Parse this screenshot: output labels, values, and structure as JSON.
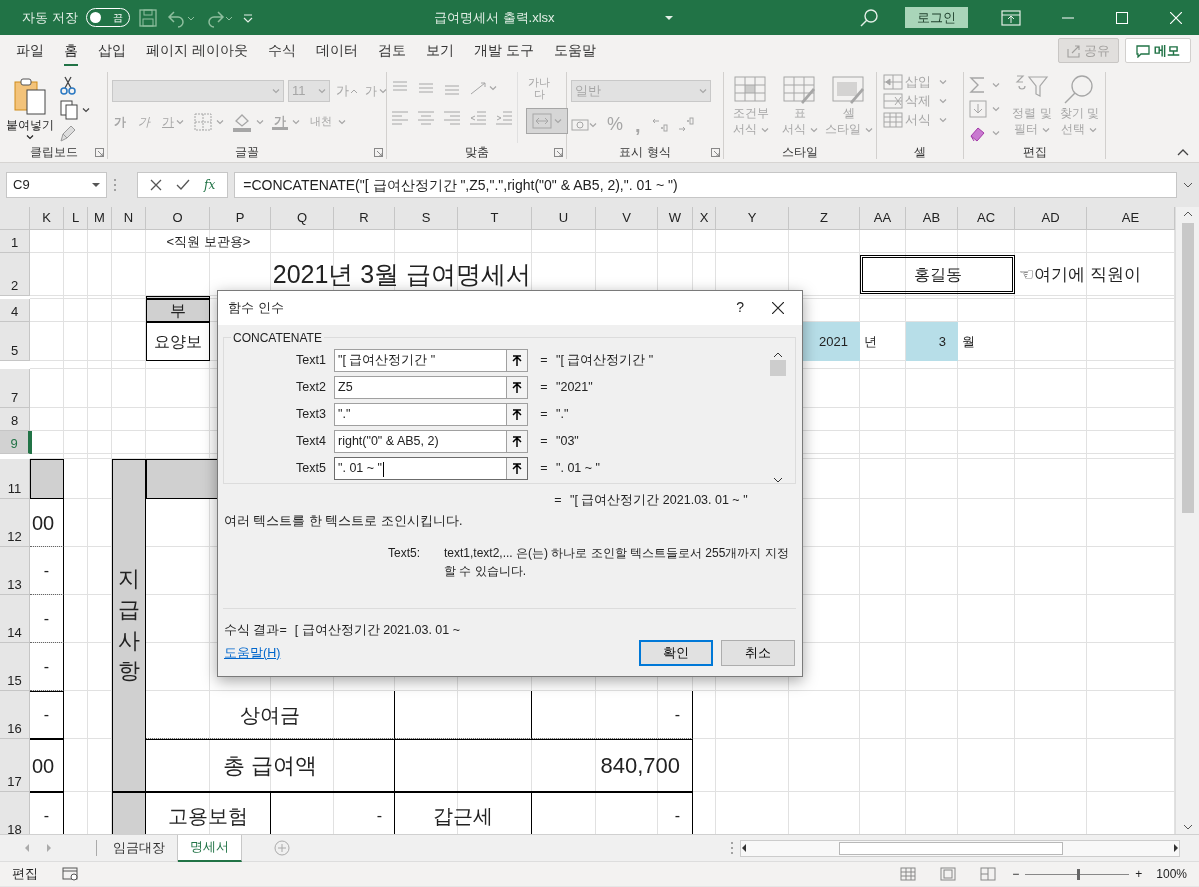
{
  "title_bar": {
    "autosave_label": "자동 저장",
    "autosave_on": false,
    "autosave_state": "끔",
    "title": "급여명세서 출력.xlsx",
    "login": "로그인"
  },
  "ribbon_tabs": [
    {
      "label": "파일",
      "selected": false
    },
    {
      "label": "홈",
      "selected": true
    },
    {
      "label": "삽입",
      "selected": false
    },
    {
      "label": "페이지 레이아웃",
      "selected": false
    },
    {
      "label": "수식",
      "selected": false
    },
    {
      "label": "데이터",
      "selected": false
    },
    {
      "label": "검토",
      "selected": false
    },
    {
      "label": "보기",
      "selected": false
    },
    {
      "label": "개발 도구",
      "selected": false
    },
    {
      "label": "도움말",
      "selected": false
    }
  ],
  "share": {
    "label": "공유",
    "disabled": true
  },
  "memo": {
    "label": "메모"
  },
  "ribbon": {
    "groups": [
      {
        "kind": "clipboard",
        "label": "클립보드",
        "disabled": false,
        "paste": "붙여넣기"
      },
      {
        "kind": "font",
        "label": "글꼴",
        "disabled": true,
        "size": "11",
        "grow": "가",
        "shrink": "가",
        "bold": "가",
        "italic": "가",
        "underline": "가",
        "font_color": "가",
        "phonetic": "내천"
      },
      {
        "kind": "align",
        "label": "맞춤",
        "disabled": true,
        "wrap": "가나다",
        "merge_on": true
      },
      {
        "kind": "number",
        "label": "표시 형식",
        "disabled": true,
        "format": "일반",
        "percent": "%",
        "comma": ","
      },
      {
        "kind": "styles",
        "label": "스타일",
        "disabled": true,
        "items": [
          {
            "lines": [
              "조건부",
              "서식"
            ]
          },
          {
            "lines": [
              "표",
              "서식"
            ]
          },
          {
            "lines": [
              "셀",
              "스타일"
            ]
          }
        ]
      },
      {
        "kind": "cells",
        "label": "셀",
        "disabled": true,
        "items": [
          "삽입",
          "삭제",
          "서식"
        ]
      },
      {
        "kind": "editing",
        "label": "편집",
        "disabled": true,
        "items": [
          {
            "lines": [
              "정렬 및",
              "필터"
            ]
          },
          {
            "lines": [
              "찾기 및",
              "선택"
            ]
          }
        ]
      }
    ]
  },
  "formula_bar": {
    "name_box": "C9",
    "insert_function": "fx",
    "formula": "=CONCATENATE(\"[ 급여산정기간 \",Z5,\".\",right(\"0\" & AB5, 2),\". 01 ~ \")"
  },
  "sheet": {
    "columns": [
      {
        "label": "K"
      },
      {
        "label": "L"
      },
      {
        "label": "M"
      },
      {
        "label": "N"
      },
      {
        "label": "O"
      },
      {
        "label": "P"
      },
      {
        "label": "Q"
      },
      {
        "label": "R"
      },
      {
        "label": "S"
      },
      {
        "label": "T"
      },
      {
        "label": "U"
      },
      {
        "label": "V"
      },
      {
        "label": "W"
      },
      {
        "label": "X"
      },
      {
        "label": "Y"
      },
      {
        "label": "Z"
      },
      {
        "label": "AA"
      },
      {
        "label": "AB"
      },
      {
        "label": "AC"
      },
      {
        "label": "AD"
      },
      {
        "label": "AE"
      }
    ],
    "rows": [
      {
        "label": "1",
        "selected": false
      },
      {
        "label": "2",
        "selected": false
      },
      {
        "label": "4",
        "selected": false
      },
      {
        "label": "5",
        "selected": false
      },
      {
        "label": "7",
        "selected": false
      },
      {
        "label": "8",
        "selected": false
      },
      {
        "label": "9",
        "selected": true
      },
      {
        "label": "11",
        "selected": false
      },
      {
        "label": "12",
        "selected": false
      },
      {
        "label": "13",
        "selected": false
      },
      {
        "label": "14",
        "selected": false
      },
      {
        "label": "15",
        "selected": false
      },
      {
        "label": "16",
        "selected": false
      },
      {
        "label": "17",
        "selected": false
      },
      {
        "label": "18",
        "selected": false
      }
    ],
    "cells": [
      {
        "text": "<직원 보관용>"
      },
      {
        "text": "2021년 3월 급여명세서"
      },
      {
        "text": "홍길동"
      },
      {
        "text": "☜여기에 직원이"
      },
      {
        "text": "부"
      },
      {
        "text": "요양보"
      },
      {
        "text": "2021"
      },
      {
        "text": "년"
      },
      {
        "text": "3"
      },
      {
        "text": "월"
      },
      {
        "text": "00"
      },
      {
        "text": "-"
      },
      {
        "text": "-"
      },
      {
        "text": "-"
      },
      {
        "text": "-"
      },
      {
        "text": "00"
      },
      {
        "text": "-"
      },
      {
        "text": "지급사항"
      },
      {
        "text": "상여금"
      },
      {
        "text": "-"
      },
      {
        "text": "총 급여액"
      },
      {
        "text": "840,700"
      },
      {
        "text": "고용보험"
      },
      {
        "text": "-"
      },
      {
        "text": "갑근세"
      },
      {
        "text": "-"
      }
    ]
  },
  "dialog": {
    "title": "함수 인수",
    "help": "?",
    "function": "CONCATENATE",
    "args": [
      {
        "label": "Text1",
        "value": "\"[ 급여산정기간 \"",
        "eq": "=",
        "result": "\"[ 급여산정기간 \"",
        "focused": false
      },
      {
        "label": "Text2",
        "value": "Z5",
        "eq": "=",
        "result": "\"2021\"",
        "focused": false
      },
      {
        "label": "Text3",
        "value": "\".\"",
        "eq": "=",
        "result": "\".\"",
        "focused": false
      },
      {
        "label": "Text4",
        "value": "right(\"0\" & AB5, 2)",
        "eq": "=",
        "result": "\"03\"",
        "focused": false
      },
      {
        "label": "Text5",
        "value": "\". 01 ~ \"",
        "eq": "=",
        "result": "\". 01 ~ \"",
        "focused": true
      }
    ],
    "total_eq": "=",
    "total": "\"[ 급여산정기간 2021.03. 01 ~ \"",
    "description": "여러 텍스트를 한 텍스트로 조인시킵니다.",
    "arg_help_label": "Text5:",
    "arg_help": "text1,text2,... 은(는) 하나로 조인할 텍스트들로서 255개까지 지정할 수 있습니다.",
    "result_label": "수식 결과=",
    "result": "[ 급여산정기간 2021.03. 01 ~",
    "help_link": "도움말(H)",
    "buttons": [
      {
        "label": "확인",
        "default": true
      },
      {
        "label": "취소",
        "default": false
      }
    ]
  },
  "sheet_tabs": [
    {
      "label": "임금대장",
      "selected": false
    },
    {
      "label": "명세서",
      "selected": true
    }
  ],
  "status_bar": {
    "mode": "편집",
    "zoom_minus": "−",
    "zoom_plus": "+",
    "zoom": "100%",
    "zoom_slider": {
      "level": 0.5
    }
  }
}
